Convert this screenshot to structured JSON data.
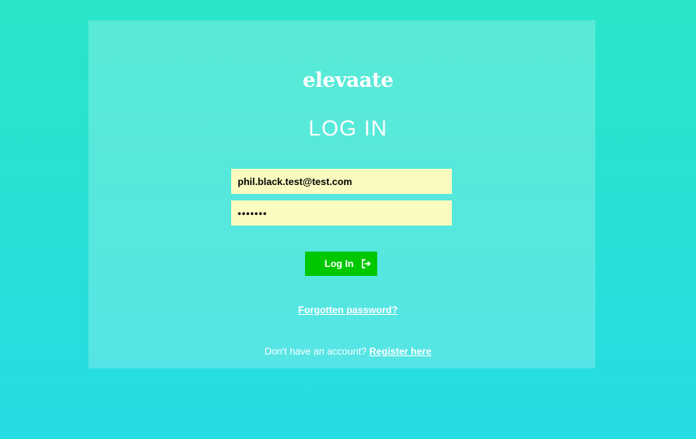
{
  "brand": {
    "logo_text": "elevaate"
  },
  "login": {
    "heading": "LOG IN",
    "email_value": "phil.black.test@test.com",
    "password_value": "pass123",
    "submit_label": "Log In",
    "submit_icon": "sign-in-icon",
    "forgot_link": "Forgotten password?",
    "register_prompt": "Don't have an account?",
    "register_link": "Register here"
  },
  "colors": {
    "background_top": "#2ae6c9",
    "background_bottom": "#25dce3",
    "input_background": "#fafbc0",
    "button_background": "#00c800",
    "text": "#ffffff"
  }
}
